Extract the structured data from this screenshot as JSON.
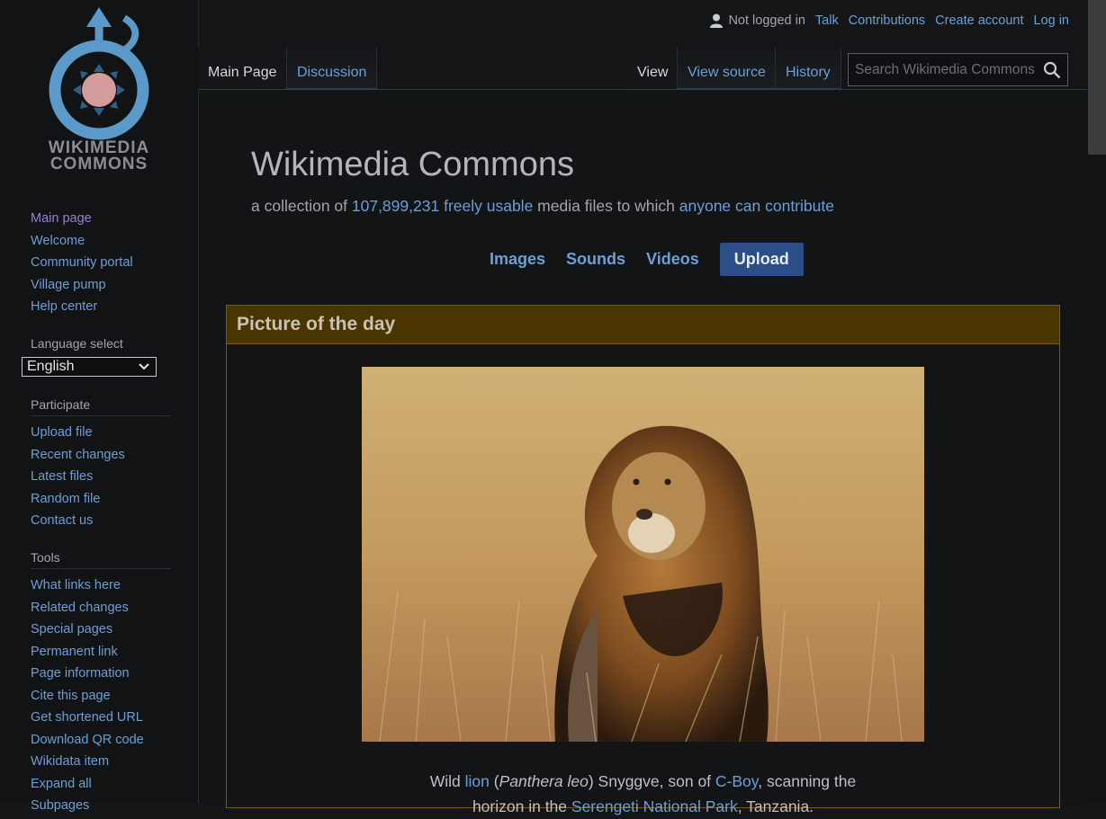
{
  "logo": {
    "line1": "WIKIMEDIA",
    "line2": "COMMONS",
    "icon": "wikimedia-commons-logo"
  },
  "personal": {
    "status": "Not logged in",
    "links": [
      "Talk",
      "Contributions",
      "Create account",
      "Log in"
    ]
  },
  "tabs": {
    "main_page": "Main Page",
    "discussion": "Discussion",
    "view": "View",
    "view_source": "View source",
    "history": "History"
  },
  "search": {
    "placeholder": "Search Wikimedia Commons"
  },
  "sidebar": {
    "navigation": [
      "Main page",
      "Welcome",
      "Community portal",
      "Village pump",
      "Help center"
    ],
    "language_label": "Language select",
    "language_value": "English",
    "participate_heading": "Participate",
    "participate": [
      "Upload file",
      "Recent changes",
      "Latest files",
      "Random file",
      "Contact us"
    ],
    "tools_heading": "Tools",
    "tools": [
      "What links here",
      "Related changes",
      "Special pages",
      "Permanent link",
      "Page information",
      "Cite this page",
      "Get shortened URL",
      "Download QR code",
      "Wikidata item",
      "Expand all",
      "Subpages"
    ]
  },
  "main": {
    "title": "Wikimedia Commons",
    "subtitle_pre": "a collection of ",
    "file_count": "107,899,231",
    "subtitle_link1": "freely usable",
    "subtitle_mid": " media files to which ",
    "subtitle_link2": "anyone can contribute",
    "media_links": [
      "Images",
      "Sounds",
      "Videos"
    ],
    "upload_label": "Upload"
  },
  "potd": {
    "heading": "Picture of the day",
    "caption_1": "Wild ",
    "caption_lion": "lion",
    "caption_2": " (",
    "caption_species": "Panthera leo",
    "caption_3": ") Snyggve, son of ",
    "caption_cboy": "C-Boy",
    "caption_4": ", scanning the",
    "caption_5": "horizon in the ",
    "caption_park": "Serengeti National Park",
    "caption_6": ", Tanzania."
  },
  "colors": {
    "background": "#131517",
    "link": "#6d9fd6",
    "visited": "#9a7fd4",
    "potd_header": "#4a3400",
    "upload_button": "#2b4e89"
  }
}
